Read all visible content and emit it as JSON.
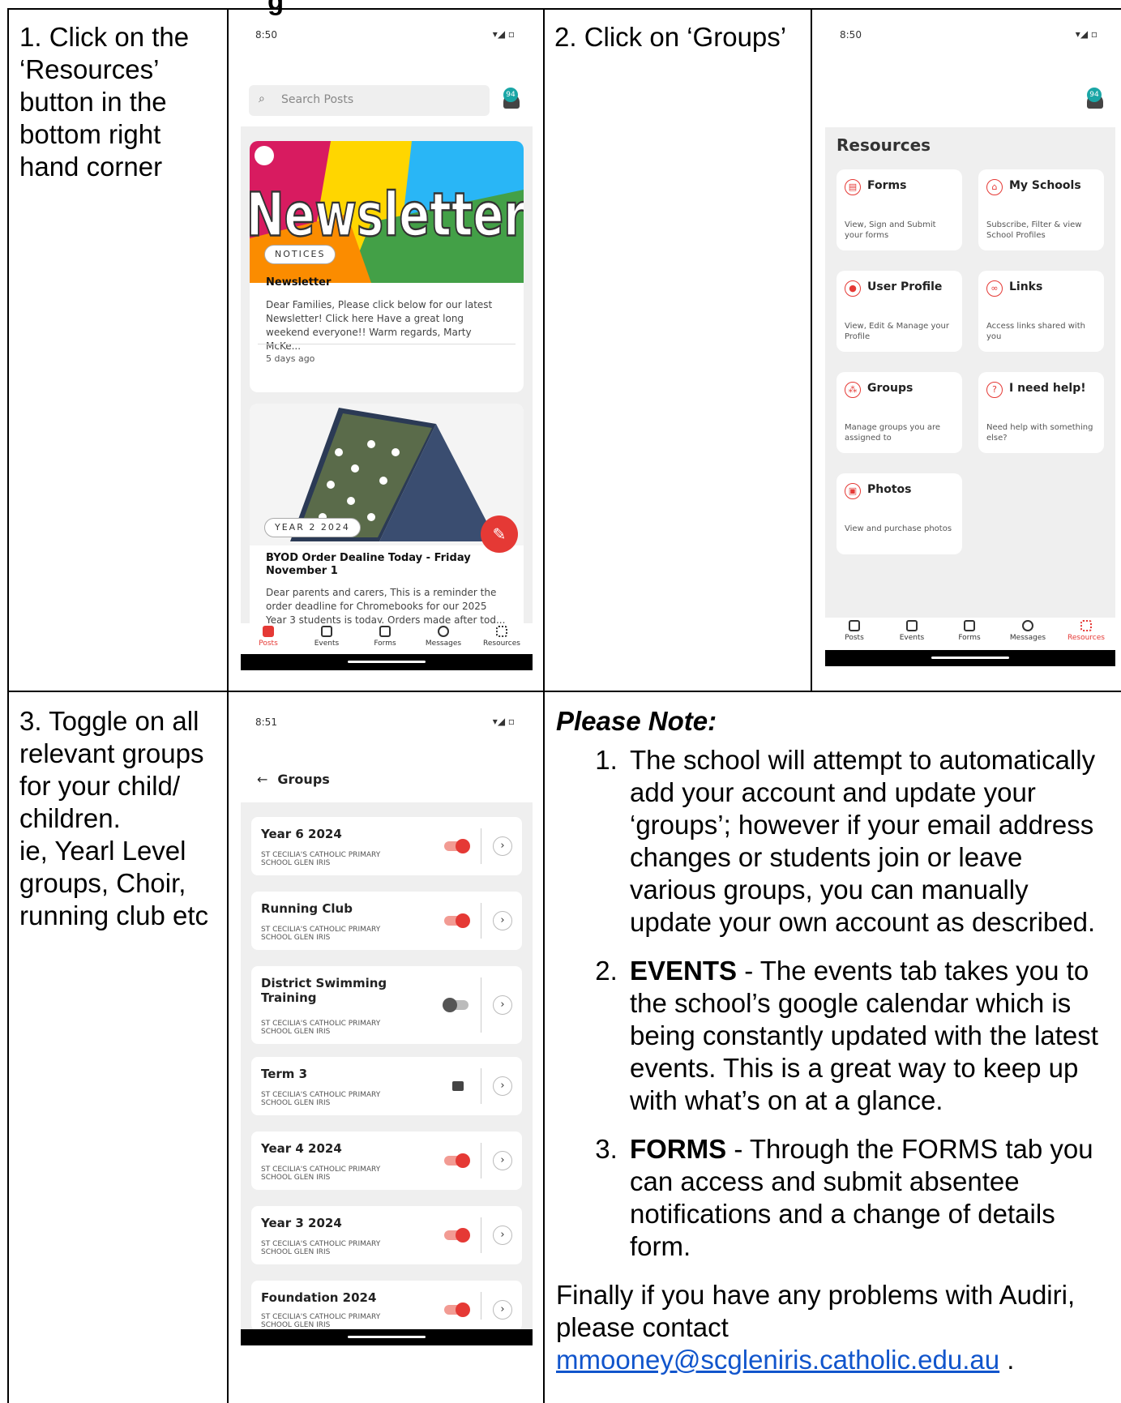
{
  "header_fragment": "g",
  "steps": [
    {
      "text": "1. Click on the ‘Resources’ button in the bottom right hand corner"
    },
    {
      "text": "2. Click on ‘Groups’"
    },
    {
      "text": "3. Toggle on all relevant groups for your child/ children.\nie, Yearl Level groups, Choir, running club etc"
    }
  ],
  "posts_screen": {
    "time": "8:50",
    "signal": "▾◢ ▫",
    "search_placeholder": "Search Posts",
    "bell_badge": "94",
    "post1": {
      "image_text": "Newsletter",
      "tag": "NOTICES",
      "title": "Newsletter",
      "body": "Dear Families,   Please click below for our latest Newsletter!   Click here       Have a great long weekend everyone!!   Warm regards,   Marty McKe...",
      "time": "5 days ago"
    },
    "post2": {
      "tag": "YEAR 2 2024",
      "title": "BYOD Order Dealine Today - Friday November 1",
      "body": "Dear parents and carers,   This is a reminder the order deadline for Chromebooks for our 2025 Year 3 students is today.   Orders made after tod..."
    },
    "tabs": [
      "Posts",
      "Events",
      "Forms",
      "Messages",
      "Resources"
    ]
  },
  "resources_screen": {
    "time": "8:50",
    "signal": "▾◢ ▫",
    "bell_badge": "94",
    "title": "Resources",
    "cards": [
      {
        "title": "Forms",
        "desc": "View, Sign and Submit your forms",
        "icon": "▤"
      },
      {
        "title": "My Schools",
        "desc": "Subscribe, Filter & view School Profiles",
        "icon": "⌂"
      },
      {
        "title": "User Profile",
        "desc": "View, Edit & Manage your Profile",
        "icon": "●"
      },
      {
        "title": "Links",
        "desc": "Access links shared with you",
        "icon": "∞"
      },
      {
        "title": "Groups",
        "desc": "Manage groups you are assigned to",
        "icon": "⁂"
      },
      {
        "title": "I need help!",
        "desc": "Need help with something else?",
        "icon": "?"
      },
      {
        "title": "Photos",
        "desc": "View and purchase photos",
        "icon": "▣"
      }
    ],
    "tabs": [
      "Posts",
      "Events",
      "Forms",
      "Messages",
      "Resources"
    ]
  },
  "groups_screen": {
    "time": "8:51",
    "signal": "▾◢ ▫",
    "header": "Groups",
    "back_icon": "←",
    "groups": [
      {
        "name": "Year 6 2024",
        "school": "ST CECILIA'S CATHOLIC PRIMARY SCHOOL GLEN IRIS",
        "state": "on"
      },
      {
        "name": "Running Club",
        "school": "ST CECILIA'S CATHOLIC PRIMARY SCHOOL GLEN IRIS",
        "state": "on"
      },
      {
        "name": "District Swimming Training",
        "school": "ST CECILIA'S CATHOLIC PRIMARY SCHOOL GLEN IRIS",
        "state": "off"
      },
      {
        "name": "Term 3",
        "school": "ST CECILIA'S CATHOLIC PRIMARY SCHOOL GLEN IRIS",
        "state": "locked"
      },
      {
        "name": "Year 4 2024",
        "school": "ST CECILIA'S CATHOLIC PRIMARY SCHOOL GLEN IRIS",
        "state": "on"
      },
      {
        "name": "Year 3 2024",
        "school": "ST CECILIA'S CATHOLIC PRIMARY SCHOOL GLEN IRIS",
        "state": "on"
      },
      {
        "name": "Foundation 2024",
        "school": "ST CECILIA'S CATHOLIC PRIMARY SCHOOL GLEN IRIS",
        "state": "on"
      }
    ]
  },
  "note": {
    "title": "Please Note:",
    "items": [
      {
        "bold": "",
        "text": "The school will attempt to automatically add your account and update your ‘groups’; however if your email address changes or students join or leave various groups, you can manually update your own account as described."
      },
      {
        "bold": "EVENTS",
        "text": " - The events tab takes you to the school’s google calendar which is being constantly updated with the latest events. This is a great way to keep up with what’s on at a glance."
      },
      {
        "bold": "FORMS",
        "text": " - Through the FORMS tab you can access and submit absentee notifications and a change of details form."
      }
    ],
    "closing": "Finally if you have any problems with Audiri, please contact",
    "email": "mmooney@scgleniris.catholic.edu.au",
    "end": " ."
  }
}
